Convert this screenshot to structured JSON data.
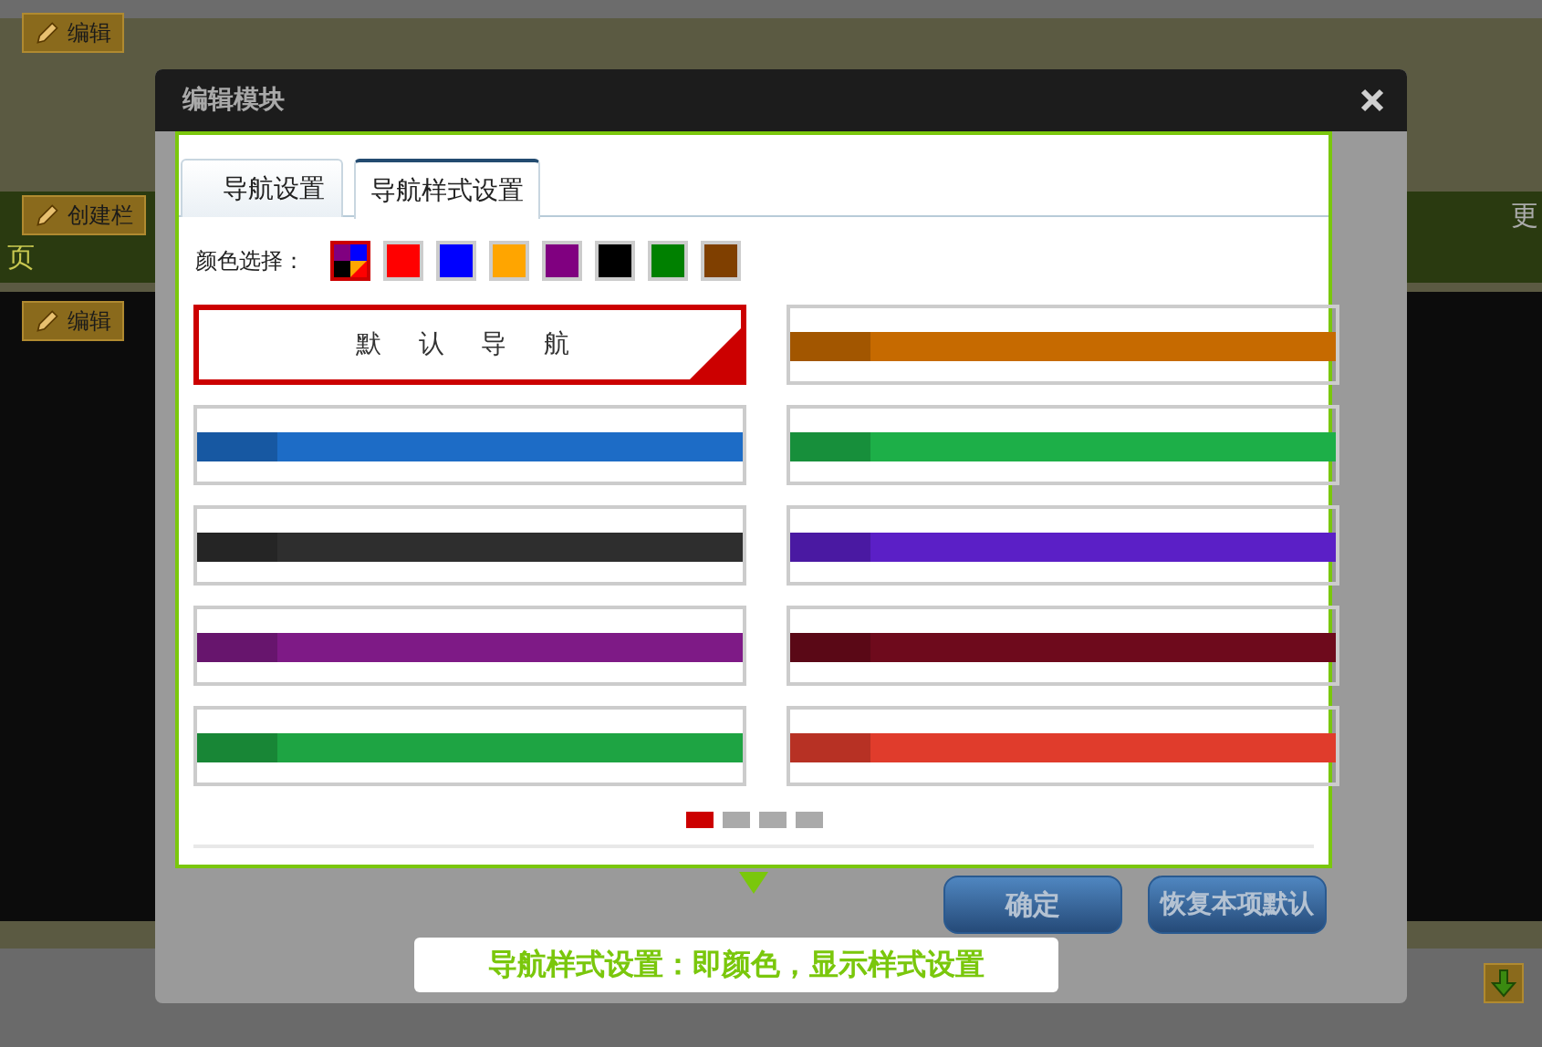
{
  "page": {
    "edit_buttons": [
      "编辑",
      "编辑"
    ],
    "create_button": "创建栏",
    "nav_left": "页",
    "nav_right": "更"
  },
  "dialog": {
    "title": "编辑模块",
    "tabs": [
      {
        "label": "导航设置",
        "selected": false
      },
      {
        "label": "导航样式设置",
        "selected": true
      }
    ],
    "color_label": "颜色选择：",
    "swatches": [
      {
        "kind": "mixed",
        "selected": true
      },
      {
        "kind": "solid",
        "color": "#ff0000",
        "selected": false
      },
      {
        "kind": "solid",
        "color": "#0000ff",
        "selected": false
      },
      {
        "kind": "solid",
        "color": "#ffa500",
        "selected": false
      },
      {
        "kind": "solid",
        "color": "#800080",
        "selected": false
      },
      {
        "kind": "solid",
        "color": "#000000",
        "selected": false
      },
      {
        "kind": "solid",
        "color": "#008000",
        "selected": false
      },
      {
        "kind": "solid",
        "color": "#7f3f00",
        "selected": false
      }
    ],
    "styles": [
      {
        "kind": "default",
        "label": "默 认 导 航",
        "selected": true
      },
      {
        "kind": "bar",
        "color": "#c66a00",
        "selected": false
      },
      {
        "kind": "bar",
        "color": "#1d6cc6",
        "selected": false
      },
      {
        "kind": "bar",
        "color": "#1daf48",
        "selected": false
      },
      {
        "kind": "bar",
        "color": "#2e2e2e",
        "selected": false
      },
      {
        "kind": "bar",
        "color": "#5b1fc6",
        "selected": false
      },
      {
        "kind": "bar",
        "color": "#7e1a86",
        "selected": false
      },
      {
        "kind": "bar",
        "color": "#6e0a1c",
        "selected": false
      },
      {
        "kind": "bar",
        "color": "#1ea443",
        "selected": false
      },
      {
        "kind": "bar",
        "color": "#e03c2c",
        "selected": false
      }
    ],
    "pages": [
      {
        "selected": true
      },
      {
        "selected": false
      },
      {
        "selected": false
      },
      {
        "selected": false
      }
    ],
    "buttons": [
      "确定",
      "恢复本项默认"
    ]
  },
  "tooltip": "导航样式设置：即颜色，显示样式设置"
}
